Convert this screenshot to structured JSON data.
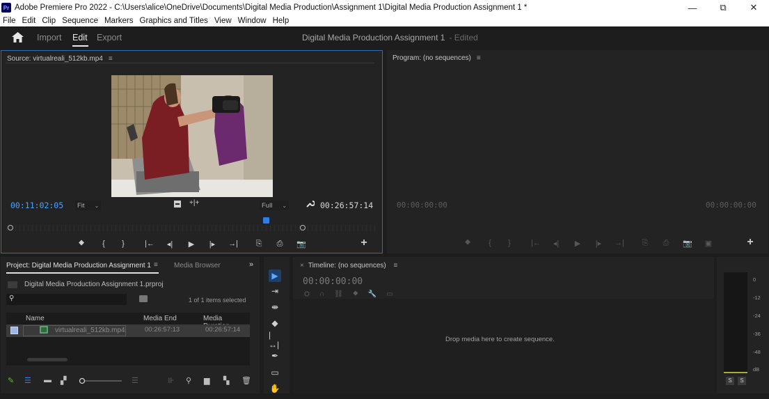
{
  "window": {
    "app_badge": "Pr",
    "title": "Adobe Premiere Pro 2022 - C:\\Users\\alice\\OneDrive\\Documents\\Digital Media Production\\Assignment 1\\Digital Media Production Assignment 1 *",
    "controls": [
      "—",
      "⧉",
      "✕"
    ]
  },
  "menu": [
    "File",
    "Edit",
    "Clip",
    "Sequence",
    "Markers",
    "Graphics and Titles",
    "View",
    "Window",
    "Help"
  ],
  "workspace": {
    "tabs": [
      "Import",
      "Edit",
      "Export"
    ],
    "active_tab": "Edit",
    "document_title": "Digital Media Production Assignment 1",
    "document_state": "- Edited"
  },
  "source": {
    "header": "Source: virtualreali_512kb.mp4",
    "menu_glyph": "≡",
    "current_tc": "00:11:02:05",
    "fit": "Fit",
    "resolution": "Full",
    "duration_tc": "00:26:57:14",
    "playhead_fraction": 0.41,
    "transport": [
      "⯁",
      "{",
      "}",
      "|←",
      "◂|",
      "▶",
      "|▸",
      "→|",
      "⎘",
      "⎙",
      "📷",
      "+"
    ]
  },
  "program": {
    "header": "Program: (no sequences)",
    "menu_glyph": "≡",
    "current_tc": "00:00:00:00",
    "duration_tc": "00:00:00:00"
  },
  "project": {
    "tab_active": "Project: Digital Media Production Assignment 1",
    "tab_inactive": "Media Browser",
    "overflow": "»",
    "file": "Digital Media Production Assignment 1.prproj",
    "selection_status": "1 of 1 items selected",
    "columns": [
      "Name",
      "Media End",
      "Media Duration"
    ],
    "rows": [
      {
        "name": "virtualreali_512kb.mp4",
        "media_end": "00:26:57:13",
        "media_duration": "00:26:57:14"
      }
    ]
  },
  "timeline": {
    "header": "Timeline: (no sequences)",
    "close": "×",
    "menu_glyph": "≡",
    "tc": "00:00:00:00",
    "drop_hint": "Drop media here to create sequence."
  },
  "meter": {
    "scale": [
      "0",
      "-12",
      "-24",
      "-36",
      "-48",
      "dB"
    ],
    "solo_labels": [
      "S",
      "S"
    ]
  },
  "colors": {
    "accent": "#2e7fe0",
    "timecode": "#4aa3ff",
    "panel_bg": "#232323",
    "app_bg": "#1d1d1d"
  }
}
